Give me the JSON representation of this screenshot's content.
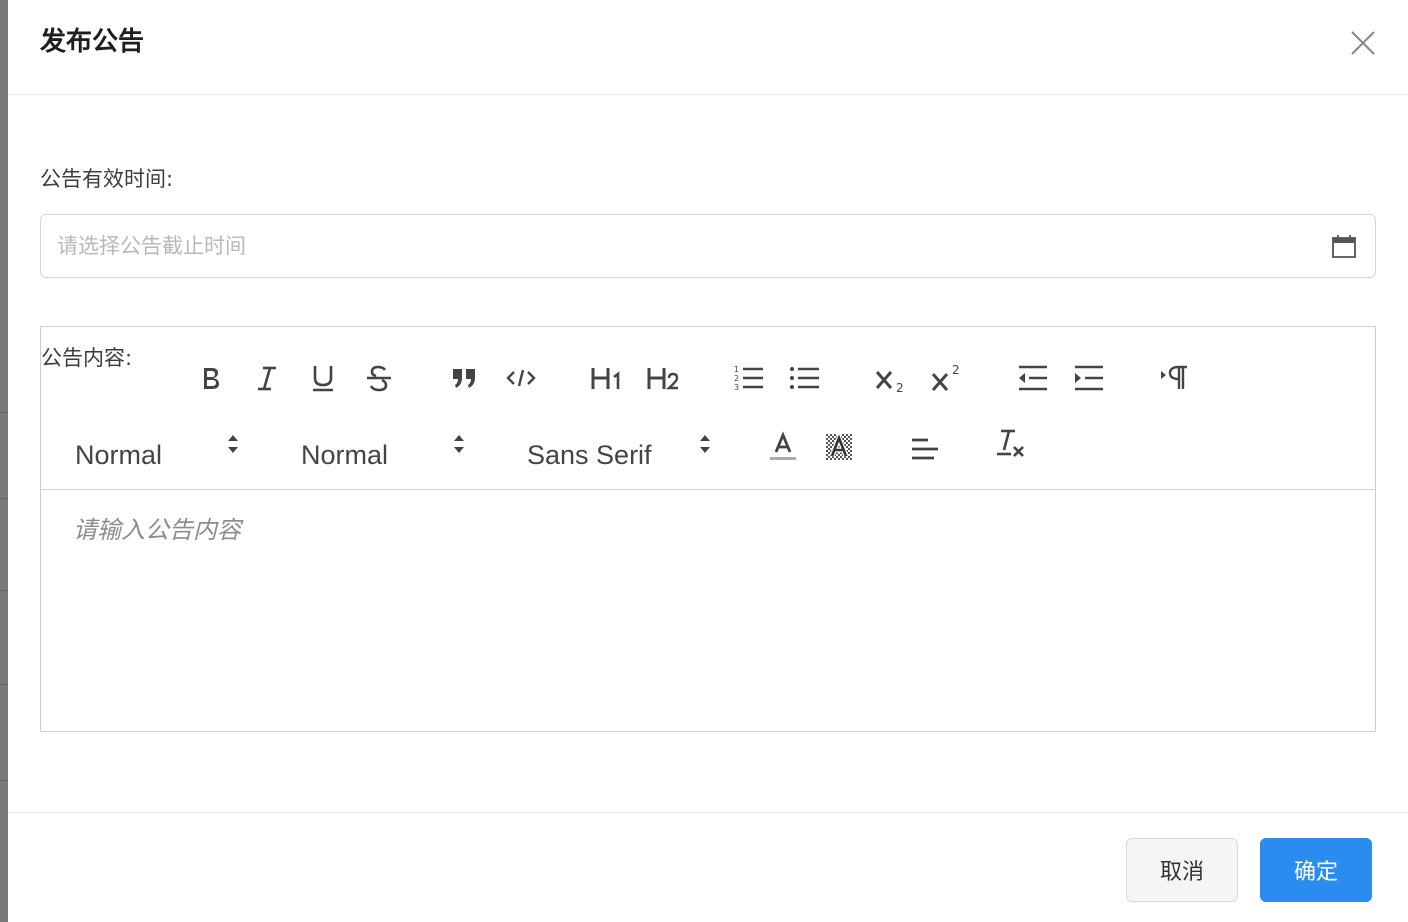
{
  "dialog": {
    "title": "发布公告"
  },
  "form": {
    "valid_time_label": "公告有效时间:",
    "valid_time_placeholder": "请选择公告截止时间",
    "valid_time_value": "",
    "content_label": "公告内容:"
  },
  "editor": {
    "size_picker": "Normal",
    "header_picker": "Normal",
    "font_picker": "Sans Serif",
    "placeholder": "请输入公告内容",
    "toolbar_icons": [
      "bold-icon",
      "italic-icon",
      "underline-icon",
      "strike-icon",
      "blockquote-icon",
      "code-block-icon",
      "header-1-icon",
      "header-2-icon",
      "ordered-list-icon",
      "bullet-list-icon",
      "subscript-icon",
      "superscript-icon",
      "outdent-icon",
      "indent-icon",
      "direction-rtl-icon",
      "text-color-icon",
      "background-color-icon",
      "align-icon",
      "clean-format-icon"
    ]
  },
  "footer": {
    "cancel_label": "取消",
    "confirm_label": "确定"
  },
  "colors": {
    "primary": "#2a8cef",
    "text": "#444444",
    "placeholder": "#b8b8b8"
  }
}
